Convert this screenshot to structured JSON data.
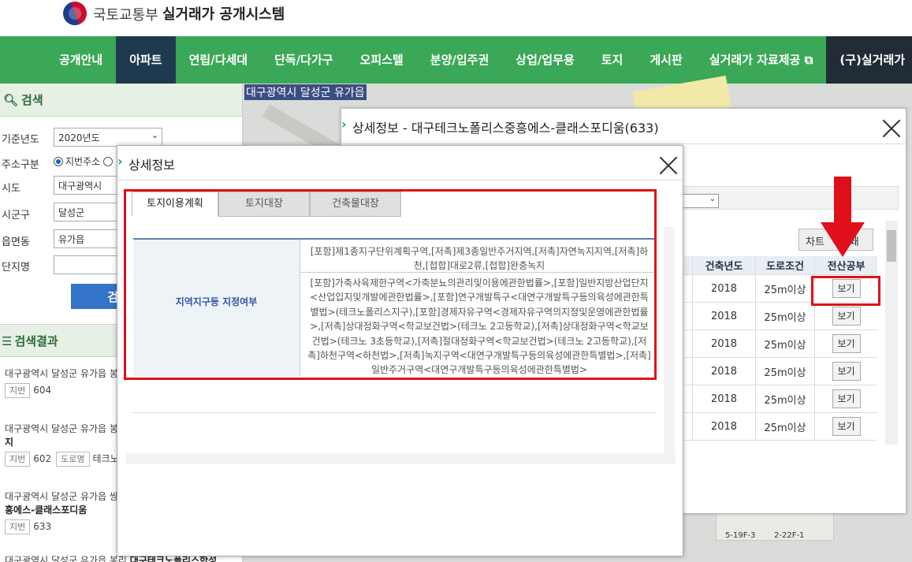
{
  "header": {
    "ministry": "국토교통부",
    "system_title": "실거래가 공개시스템"
  },
  "nav": [
    "공개안내",
    "아파트",
    "연립/다세대",
    "단독/다가구",
    "오피스텔",
    "분양/입주권",
    "상업/업무용",
    "토지",
    "게시판",
    "실거래가 자료제공",
    "(구)실거래가"
  ],
  "nav_external_icon": "⧉",
  "map": {
    "location_label": "대구광역시 달성군 유가읍",
    "labels": [
      "5-19F-3",
      "2-22F-1"
    ]
  },
  "sidebar": {
    "search_title": "검색",
    "fields": {
      "year_label": "기준년도",
      "year_value": "2020년도",
      "addr_type_label": "주소구분",
      "addr_type_value": "지번주소",
      "sido_label": "시도",
      "sido_value": "대구광역시",
      "sigungu_label": "시군구",
      "sigungu_value": "달성군",
      "eup_label": "읍면동",
      "eup_value": "유가읍",
      "complex_label": "단지명",
      "complex_value": ""
    },
    "search_button": "검",
    "results_title": "검색결과",
    "results": [
      {
        "addr": "대구광역시 달성군 유가읍 봉",
        "tag1": "지번",
        "val1": "604"
      },
      {
        "addr": "대구광역시 달성군 유가읍 봉",
        "name": "지",
        "tag1": "지번",
        "val1": "602",
        "tag2": "도로명",
        "val2": "테크노"
      },
      {
        "addr": "대구광역시 달성군 유가읍 쌍",
        "name": "흥에스-클래스포디움",
        "tag1": "지번",
        "val1": "633"
      },
      {
        "addr": "대구광역시 달성군 유가읍 봉리",
        "name": "대구테크노폴리스한성"
      }
    ]
  },
  "back_dialog": {
    "title": "상세정보 - 대구테크노폴리스중흥에스-클래스포디움(633)",
    "chart_button": "차트",
    "chart_button_suffix": "쇄",
    "table": {
      "headers": [
        "건축년도",
        "도로조건",
        "전산공부"
      ],
      "rows": [
        {
          "year": "2018",
          "road": "25m이상",
          "action": "보기"
        },
        {
          "year": "2018",
          "road": "25m이상",
          "action": "보기"
        },
        {
          "year": "2018",
          "road": "25m이상",
          "action": "보기"
        },
        {
          "year": "2018",
          "road": "25m이상",
          "action": "보기"
        },
        {
          "year": "2018",
          "road": "25m이상",
          "action": "보기"
        },
        {
          "year": "2018",
          "road": "25m이상",
          "action": "보기"
        }
      ]
    }
  },
  "front_dialog": {
    "title": "상세정보",
    "tabs": [
      "토지이용계획",
      "토지대장",
      "건축물대장"
    ],
    "active_tab": "토지이용계획",
    "land_use": {
      "label": "지역지구등 지정여부",
      "line1": "[포함]제1종지구단위계획구역,[저촉]제3종일반주거지역,[저촉]자연녹지지역,[저촉]하천,[접합]대로2류,[접합]완충녹지",
      "line2": "[포함]가축사육제한구역<가축분뇨의관리및이용에관한법률>,[포함]일반지방산업단지<산업입지및개발에관한법률>,[포함]연구개발특구<대연구개발특구등의육성에관한특별법>(테크노폴리스지구),[포함]경제자유구역<경제자유구역의지정및운영에관한법률>,[저촉]상대정화구역<학교보건법>(테크노 2고등학교),[저촉]상대정화구역<학교보건법>(테크노 3초등학교),[저촉]절대정화구역<학교보건법>(테크노 2고등학교),[저촉]하천구역<하천법>,[저촉]녹지구역<대연구개발특구등의육성에관한특별법>,[저촉]일반주거구역<대연구개발특구등의육성에관한특별법>"
    }
  },
  "colors": {
    "nav_green": "#3aa856",
    "active_nav": "#1f3a4f",
    "highlight_red": "#e0101a",
    "link_blue": "#3057a5"
  }
}
